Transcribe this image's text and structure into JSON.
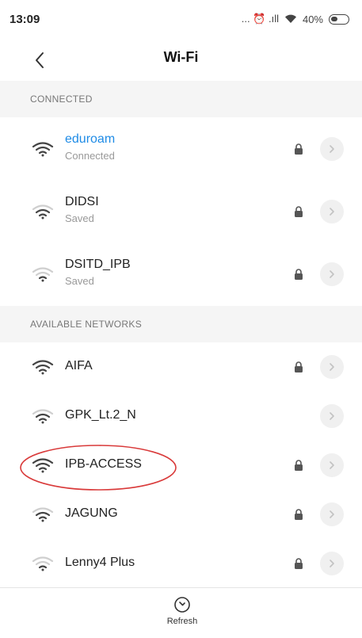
{
  "status_bar": {
    "time": "13:09",
    "icons_text": "... ⏰ .ıll",
    "battery": "40%"
  },
  "header": {
    "title": "Wi-Fi",
    "back_icon": "chevron-left-icon"
  },
  "sections": {
    "connected_title": "CONNECTED",
    "available_title": "AVAILABLE NETWORKS"
  },
  "connected_networks": [
    {
      "name": "eduroam",
      "status": "Connected",
      "secured": true,
      "signal": "strong"
    },
    {
      "name": "DIDSI",
      "status": "Saved",
      "secured": true,
      "signal": "medium"
    },
    {
      "name": "DSITD_IPB",
      "status": "Saved",
      "secured": true,
      "signal": "weak"
    }
  ],
  "available_networks": [
    {
      "name": "AIFA",
      "secured": true,
      "signal": "strong"
    },
    {
      "name": "GPK_Lt.2_N",
      "secured": false,
      "signal": "medium"
    },
    {
      "name": "IPB-ACCESS",
      "secured": true,
      "signal": "strong"
    },
    {
      "name": "JAGUNG",
      "secured": true,
      "signal": "medium"
    },
    {
      "name": "Lenny4 Plus",
      "secured": true,
      "signal": "weak"
    }
  ],
  "footer": {
    "refresh_label": "Refresh"
  },
  "colors": {
    "accent": "#1e8be6",
    "highlight": "#d93a3a",
    "section_bg": "#f5f5f5"
  }
}
